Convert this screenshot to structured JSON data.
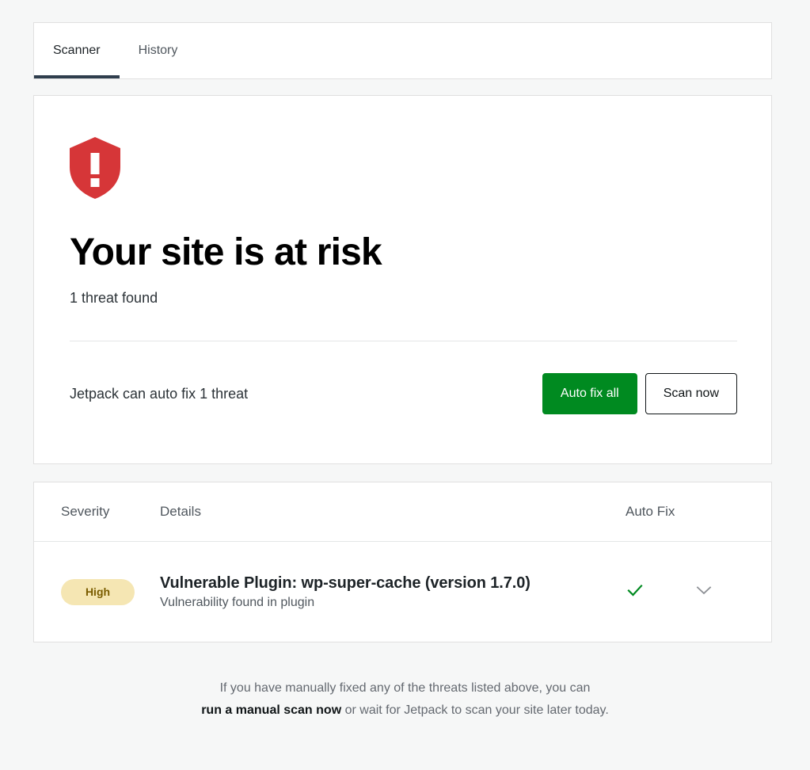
{
  "theme": {
    "page_background": "#f6f7f7",
    "card_background": "#ffffff",
    "border": "#e0e0e0",
    "accent_green": "#008a20",
    "danger_red": "#d63638",
    "badge_background": "#f5e6b3",
    "badge_text": "#7a5c00",
    "active_tab_underline": "#2f3e4d",
    "check_green": "#008a20",
    "chevron_gray": "#8c8f94"
  },
  "tabs": [
    {
      "label": "Scanner",
      "active": true
    },
    {
      "label": "History",
      "active": false
    }
  ],
  "status": {
    "icon": "shield-alert-icon",
    "title": "Your site is at risk",
    "subtitle": "1 threat found",
    "action_text": "Jetpack can auto fix 1 threat",
    "primary_button": "Auto fix all",
    "secondary_button": "Scan now"
  },
  "threats_table": {
    "columns": {
      "severity": "Severity",
      "details": "Details",
      "auto_fix": "Auto Fix"
    },
    "rows": [
      {
        "severity": "High",
        "title": "Vulnerable Plugin: wp-super-cache (version 1.7.0)",
        "description": "Vulnerability found in plugin",
        "auto_fix_available": true,
        "auto_fix_icon": "check-icon",
        "expand_icon": "chevron-down-icon"
      }
    ]
  },
  "footer": {
    "line1": "If you have manually fixed any of the threats listed above, you can",
    "link": "run a manual scan now",
    "line2_suffix": " or wait for Jetpack to scan your site later today."
  }
}
